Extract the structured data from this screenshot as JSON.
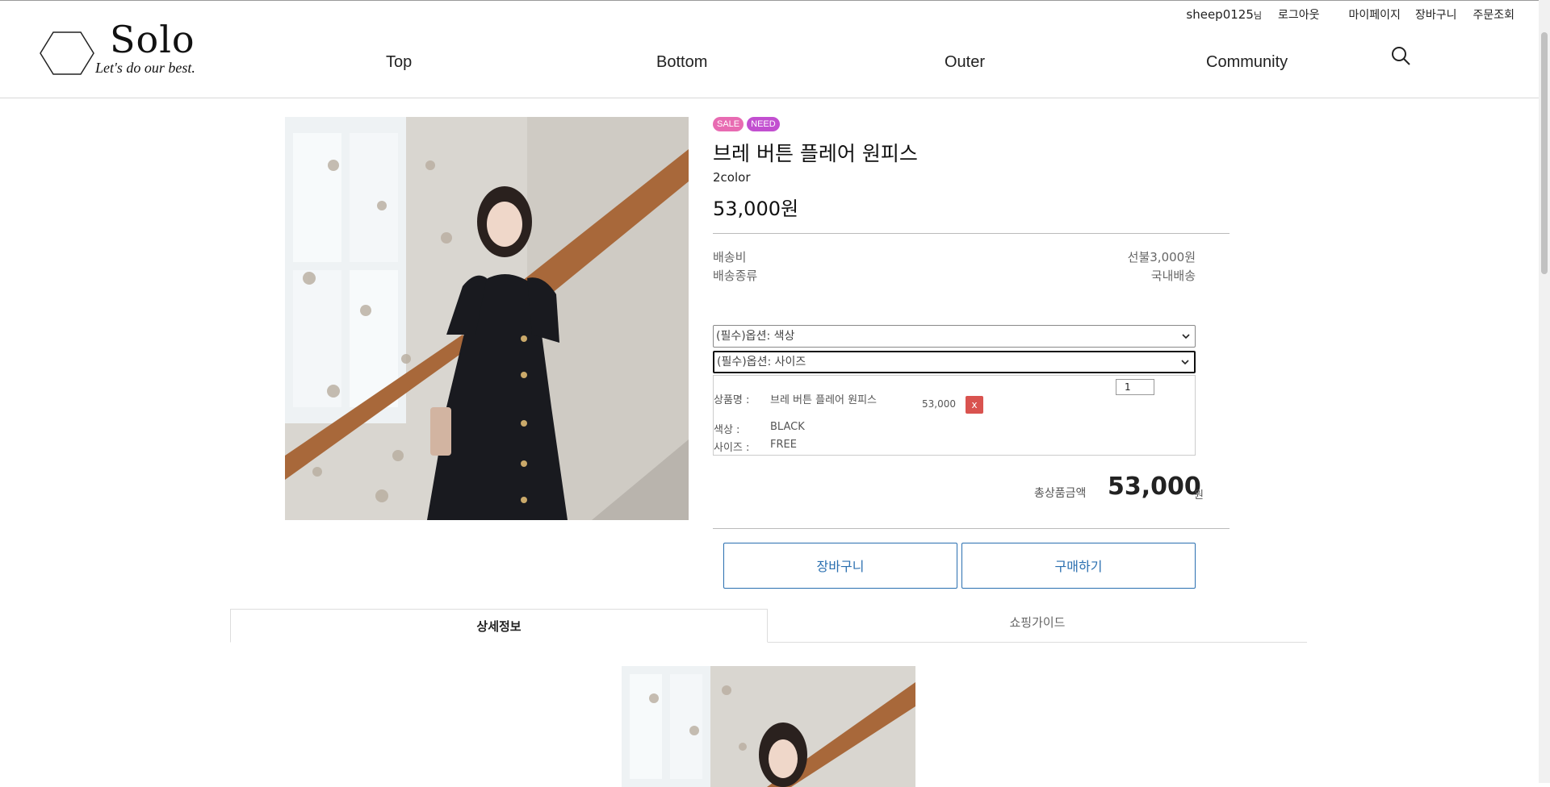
{
  "header": {
    "logo": {
      "title": "Solo",
      "tagline": "Let's do our best."
    },
    "user": {
      "name": "sheep0125",
      "suffix": "님"
    },
    "util_links": [
      "로그아웃",
      "마이페이지",
      "장바구니",
      "주문조회"
    ],
    "nav": [
      "Top",
      "Bottom",
      "Outer",
      "Community"
    ]
  },
  "product": {
    "badges": [
      "SALE",
      "NEED"
    ],
    "name": "브레 버튼 플레어 원피스",
    "colors": "2color",
    "price": "53,000원",
    "shipping": [
      {
        "label": "배송비",
        "value": "선불3,000원"
      },
      {
        "label": "배송종류",
        "value": "국내배송"
      }
    ],
    "options": {
      "color_select": "(필수)옵션: 색상",
      "size_select": "(필수)옵션: 사이즈"
    },
    "selected": {
      "name_label": "상품명 :",
      "name": "브레 버튼 플레어 원피스",
      "price": "53,000",
      "quantity": "1",
      "remove": "x",
      "color_label": "색상 :",
      "color": "BLACK",
      "size_label": "사이즈 :",
      "size": "FREE"
    },
    "total": {
      "label": "총상품금액",
      "value": "53,000",
      "unit": "원"
    },
    "buttons": {
      "cart": "장바구니",
      "buy": "구매하기"
    }
  },
  "tabs": [
    "상세정보",
    "쇼핑가이드"
  ]
}
